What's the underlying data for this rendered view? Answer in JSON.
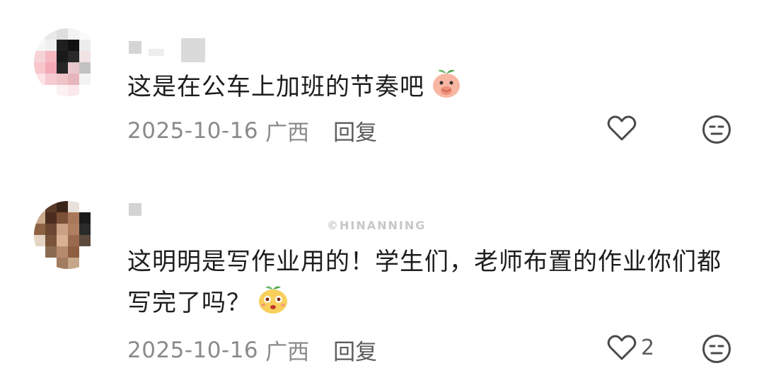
{
  "watermark": "©HINANNING",
  "comments": [
    {
      "text": "这是在公车上加班的节奏吧",
      "emoji": "peach-covering-mouth-emoji",
      "date": "2025-10-16",
      "location": "广西",
      "reply_label": "回复",
      "like_count": ""
    },
    {
      "text": "这明明是写作业用的！学生们，老师布置的作业你们都写完了吗？",
      "emoji": "yellow-grinning-emoji",
      "date": "2025-10-16",
      "location": "广西",
      "reply_label": "回复",
      "like_count": "2"
    }
  ],
  "colors": {
    "text": "#1d1d1d",
    "meta": "#8a8a8a",
    "icon": "#4a4a4a"
  }
}
